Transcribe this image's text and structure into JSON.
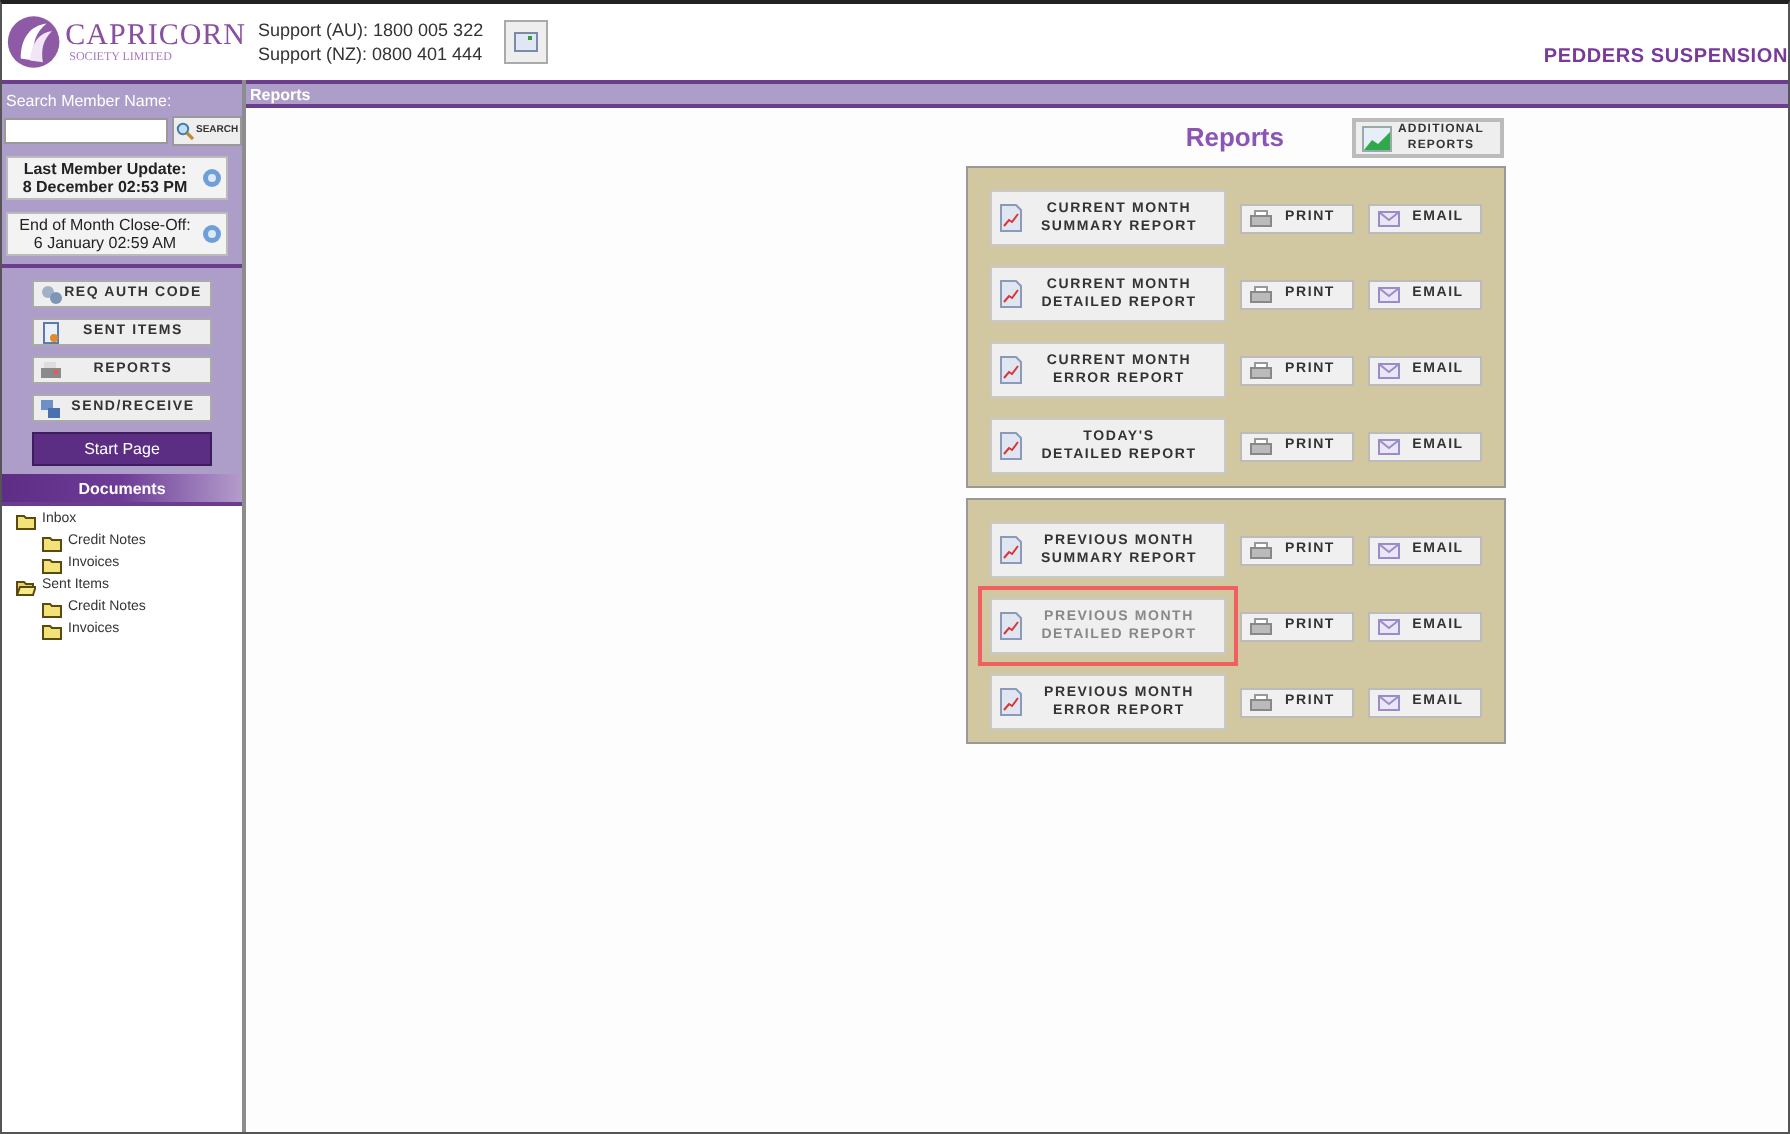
{
  "header": {
    "logo_title": "CAPRICORN",
    "logo_subtitle": "SOCIETY LIMITED",
    "support": [
      "Support (AU): 1800 005 322",
      "Support (NZ): 0800 401 444"
    ],
    "member_name": "PEDDERS SUSPENSION"
  },
  "sidebar": {
    "search_label": "Search Member Name:",
    "search_button": "SEARCH",
    "info": [
      {
        "label": "Last Member Update:",
        "value": "8 December 02:53 PM",
        "bold": true
      },
      {
        "label": "End of Month Close-Off:",
        "value": "6 January 02:59 AM",
        "bold": false
      }
    ],
    "actions": [
      {
        "label": "REQ AUTH CODE",
        "kind": "key"
      },
      {
        "label": "SENT ITEMS",
        "kind": "document"
      },
      {
        "label": "REPORTS",
        "kind": "printer"
      },
      {
        "label": "SEND/RECEIVE",
        "kind": "network"
      }
    ],
    "start_page": "Start Page",
    "documents_title": "Documents",
    "tree": [
      {
        "label": "Inbox",
        "open": false,
        "children": [
          {
            "label": "Credit Notes",
            "open": false
          },
          {
            "label": "Invoices",
            "open": false
          }
        ]
      },
      {
        "label": "Sent Items",
        "open": true,
        "children": [
          {
            "label": "Credit Notes",
            "open": false
          },
          {
            "label": "Invoices",
            "open": false
          }
        ]
      }
    ]
  },
  "content": {
    "bar_title": "Reports",
    "heading": "Reports",
    "additional_button": [
      "ADDITIONAL",
      "REPORTS"
    ],
    "groups": [
      {
        "rows": [
          {
            "title": [
              "CURRENT MONTH",
              "SUMMARY REPORT"
            ],
            "print": "PRINT",
            "email": "EMAIL",
            "highlighted": false
          },
          {
            "title": [
              "CURRENT MONTH",
              "DETAILED REPORT"
            ],
            "print": "PRINT",
            "email": "EMAIL",
            "highlighted": false
          },
          {
            "title": [
              "CURRENT MONTH",
              "ERROR REPORT"
            ],
            "print": "PRINT",
            "email": "EMAIL",
            "highlighted": false
          },
          {
            "title": [
              "TODAY'S",
              "DETAILED REPORT"
            ],
            "print": "PRINT",
            "email": "EMAIL",
            "highlighted": false
          }
        ]
      },
      {
        "rows": [
          {
            "title": [
              "PREVIOUS MONTH",
              "SUMMARY REPORT"
            ],
            "print": "PRINT",
            "email": "EMAIL",
            "highlighted": false
          },
          {
            "title": [
              "PREVIOUS MONTH",
              "DETAILED REPORT"
            ],
            "print": "PRINT",
            "email": "EMAIL",
            "highlighted": true
          },
          {
            "title": [
              "PREVIOUS MONTH",
              "ERROR REPORT"
            ],
            "print": "PRINT",
            "email": "EMAIL",
            "highlighted": false
          }
        ]
      }
    ]
  }
}
